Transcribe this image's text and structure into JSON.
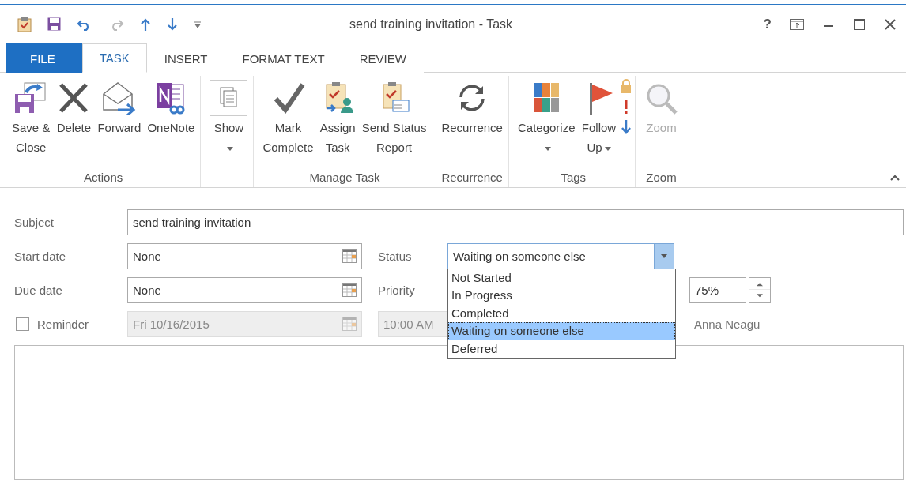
{
  "window": {
    "title": "send training invitation - Task",
    "help": "?"
  },
  "ribbon_tabs": [
    {
      "label": "FILE",
      "kind": "file",
      "selected": false
    },
    {
      "label": "TASK",
      "kind": "tab",
      "selected": true
    },
    {
      "label": "INSERT",
      "kind": "tab",
      "selected": false
    },
    {
      "label": "FORMAT TEXT",
      "kind": "tab",
      "selected": false
    },
    {
      "label": "REVIEW",
      "kind": "tab",
      "selected": false
    }
  ],
  "ribbon_groups": [
    {
      "label": "Actions",
      "buttons": [
        {
          "lines": [
            "Save &",
            "Close"
          ]
        },
        {
          "lines": [
            "Delete"
          ]
        },
        {
          "lines": [
            "Forward"
          ]
        },
        {
          "lines": [
            "OneNote"
          ]
        }
      ]
    },
    {
      "buttons": [
        {
          "lines": [
            "Show"
          ],
          "dropdown": true
        }
      ]
    },
    {
      "label": "Manage Task",
      "buttons": [
        {
          "lines": [
            "Mark",
            "Complete"
          ]
        },
        {
          "lines": [
            "Assign",
            "Task"
          ]
        },
        {
          "lines": [
            "Send Status",
            "Report"
          ]
        }
      ]
    },
    {
      "label": "Recurrence",
      "buttons": [
        {
          "lines": [
            "Recurrence"
          ]
        }
      ]
    },
    {
      "label": "Tags",
      "buttons": [
        {
          "lines": [
            "Categorize"
          ],
          "dropdown": true
        },
        {
          "lines": [
            "Follow",
            "Up"
          ],
          "dropdown": true
        }
      ],
      "small_icons": true
    },
    {
      "label": "Zoom",
      "buttons": [
        {
          "lines": [
            "Zoom"
          ],
          "disabled": true
        }
      ]
    }
  ],
  "form": {
    "subject": {
      "label": "Subject",
      "value": "send training invitation"
    },
    "start_date": {
      "label": "Start date",
      "value": "None"
    },
    "due_date": {
      "label": "Due date",
      "value": "None"
    },
    "reminder": {
      "label": "Reminder",
      "checked": false,
      "disabled": true,
      "date": "Fri 10/16/2015",
      "time": "10:00 AM"
    },
    "status": {
      "label": "Status",
      "value": "Waiting on someone else",
      "expanded": true,
      "options": [
        {
          "label": "Not Started",
          "selected": false
        },
        {
          "label": "In Progress",
          "selected": false
        },
        {
          "label": "Completed",
          "selected": false
        },
        {
          "label": "Waiting on someone else",
          "selected": true
        },
        {
          "label": "Deferred",
          "selected": false
        }
      ]
    },
    "priority": {
      "label": "Priority"
    },
    "percent_complete": {
      "value": "75%"
    },
    "owner": "Anna Neagu"
  }
}
